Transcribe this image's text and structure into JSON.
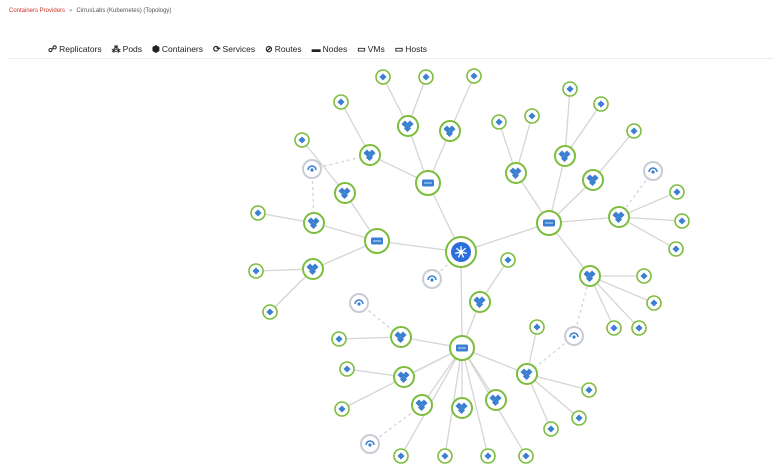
{
  "breadcrumb": {
    "parent": "Containers Providers",
    "separator": "»",
    "current": "CirrusLabs (Kubernetes) (Topology)"
  },
  "filters": [
    {
      "label": "Replicators",
      "icon": "replicator-icon"
    },
    {
      "label": "Pods",
      "icon": "pod-icon"
    },
    {
      "label": "Containers",
      "icon": "container-icon"
    },
    {
      "label": "Services",
      "icon": "service-icon"
    },
    {
      "label": "Routes",
      "icon": "route-icon"
    },
    {
      "label": "Nodes",
      "icon": "node-icon"
    },
    {
      "label": "VMs",
      "icon": "vm-icon"
    },
    {
      "label": "Hosts",
      "icon": "host-icon"
    }
  ],
  "colors": {
    "link": "#d1352b",
    "node_ring": "#7cbd3e",
    "service_ring": "#c7ccd6",
    "icon_blue": "#3a7fd0",
    "center_fill": "#2a6fdb",
    "edge": "#d5d5d5"
  }
}
